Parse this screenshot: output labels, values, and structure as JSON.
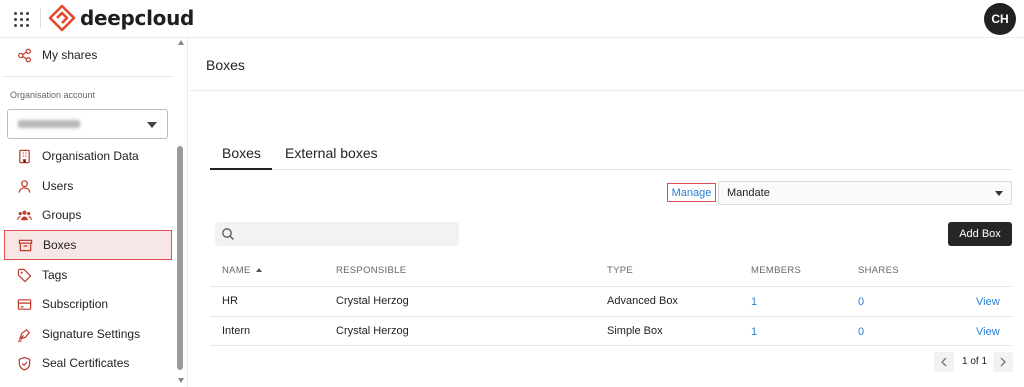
{
  "app": {
    "logo_text": "deepcloud",
    "user_initials": "CH"
  },
  "colors": {
    "brand": "#e8472c",
    "link": "#2a7fd4",
    "active_bg": "#f7e6e6",
    "highlight_border": "#e05050"
  },
  "sidebar": {
    "top_item": {
      "label": "My shares",
      "icon": "share-icon"
    },
    "org_label": "Organisation account",
    "items": [
      {
        "label": "Organisation Data",
        "icon": "building-icon"
      },
      {
        "label": "Users",
        "icon": "user-icon"
      },
      {
        "label": "Groups",
        "icon": "users-icon"
      },
      {
        "label": "Boxes",
        "icon": "archive-box-icon",
        "active": true
      },
      {
        "label": "Tags",
        "icon": "tag-icon"
      },
      {
        "label": "Subscription",
        "icon": "credit-card-icon"
      },
      {
        "label": "Signature Settings",
        "icon": "pen-nib-icon"
      },
      {
        "label": "Seal Certificates",
        "icon": "shield-check-icon"
      }
    ]
  },
  "main": {
    "title": "Boxes",
    "tabs": [
      {
        "label": "Boxes",
        "active": true
      },
      {
        "label": "External boxes"
      }
    ],
    "manage_label": "Manage",
    "mandate_value": "Mandate",
    "search_placeholder": "",
    "add_box_label": "Add Box",
    "table": {
      "headers": [
        "NAME",
        "RESPONSIBLE",
        "TYPE",
        "MEMBERS",
        "SHARES"
      ],
      "rows": [
        {
          "name": "HR",
          "responsible": "Crystal Herzog",
          "type": "Advanced Box",
          "members": "1",
          "shares": "0",
          "action": "View"
        },
        {
          "name": "Intern",
          "responsible": "Crystal Herzog",
          "type": "Simple Box",
          "members": "1",
          "shares": "0",
          "action": "View"
        }
      ]
    },
    "pagination": {
      "text": "1 of 1"
    }
  }
}
